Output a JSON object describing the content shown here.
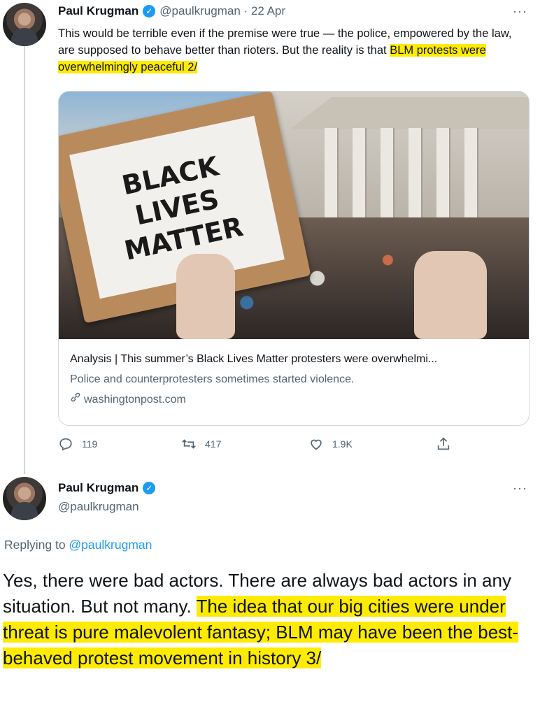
{
  "tweet1": {
    "name": "Paul Krugman",
    "handle_date": "@paulkrugman · 22 Apr",
    "more": "···",
    "text_plain": "This would be terrible even if the premise were true — the police, empowered by the law, are supposed to behave better than rioters. But the reality is that ",
    "text_highlight": "BLM protests were overwhelmingly peaceful 2/",
    "card": {
      "sign_line1": "BLACK",
      "sign_line2": "LIVES",
      "sign_line3": "MATTER",
      "title": "Analysis | This summer’s Black Lives Matter protesters were overwhelmi...",
      "description": "Police and counterprotesters sometimes started violence.",
      "domain": "washingtonpost.com"
    },
    "actions": {
      "replies": "119",
      "retweets": "417",
      "likes": "1.9K"
    }
  },
  "tweet2": {
    "name": "Paul Krugman",
    "handle": "@paulkrugman",
    "more": "···",
    "replying_prefix": "Replying to ",
    "replying_handle": "@paulkrugman",
    "text_plain": "Yes, there were bad actors. There are always bad actors in any situation. But not many. ",
    "text_highlight": "The idea that our big cities were under threat is pure malevolent fantasy; BLM may have been the best-behaved protest movement in history 3/"
  },
  "colors": {
    "highlight": "#ffeb00",
    "link": "#1d9bf0",
    "muted": "#536471",
    "verified": "#1d9bf0"
  },
  "icons": [
    "verified-badge-icon",
    "more-icon",
    "link-icon",
    "reply-icon",
    "retweet-icon",
    "like-icon",
    "share-icon"
  ]
}
